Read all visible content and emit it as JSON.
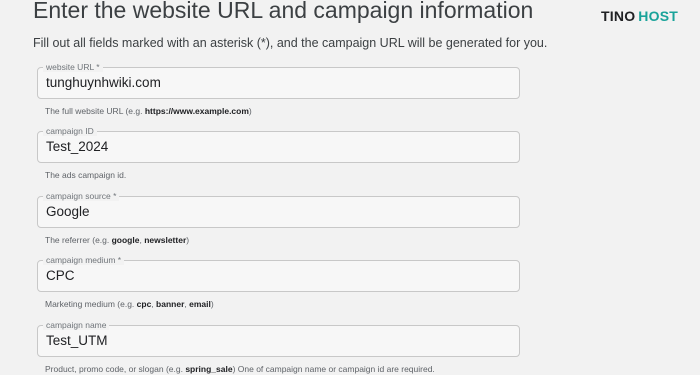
{
  "header": {
    "title": "Enter the website URL and campaign information",
    "logo_part1": "TINO",
    "logo_part2": "HOST",
    "intro": "Fill out all fields marked with an asterisk (*), and the campaign URL will be generated for you."
  },
  "fields": {
    "website_url": {
      "label": "website URL *",
      "value": "tunghuynhwiki.com",
      "help_pre": "The full website URL (e.g. ",
      "help_bold": "https://www.example.com",
      "help_post": ")"
    },
    "campaign_id": {
      "label": "campaign ID",
      "value": "Test_2024",
      "help": "The ads campaign id."
    },
    "campaign_source": {
      "label": "campaign source *",
      "value": "Google",
      "help_pre": "The referrer (e.g. ",
      "help_bold1": "google",
      "help_sep": ", ",
      "help_bold2": "newsletter",
      "help_post": ")"
    },
    "campaign_medium": {
      "label": "campaign medium *",
      "value": "CPC",
      "help_pre": "Marketing medium (e.g. ",
      "help_bold1": "cpc",
      "help_sep1": ", ",
      "help_bold2": "banner",
      "help_sep2": ", ",
      "help_bold3": "email",
      "help_post": ")"
    },
    "campaign_name": {
      "label": "campaign name",
      "value": "Test_UTM",
      "help_pre": "Product, promo code, or slogan (e.g. ",
      "help_bold": "spring_sale",
      "help_post": ") One of campaign name or campaign id are required."
    }
  }
}
